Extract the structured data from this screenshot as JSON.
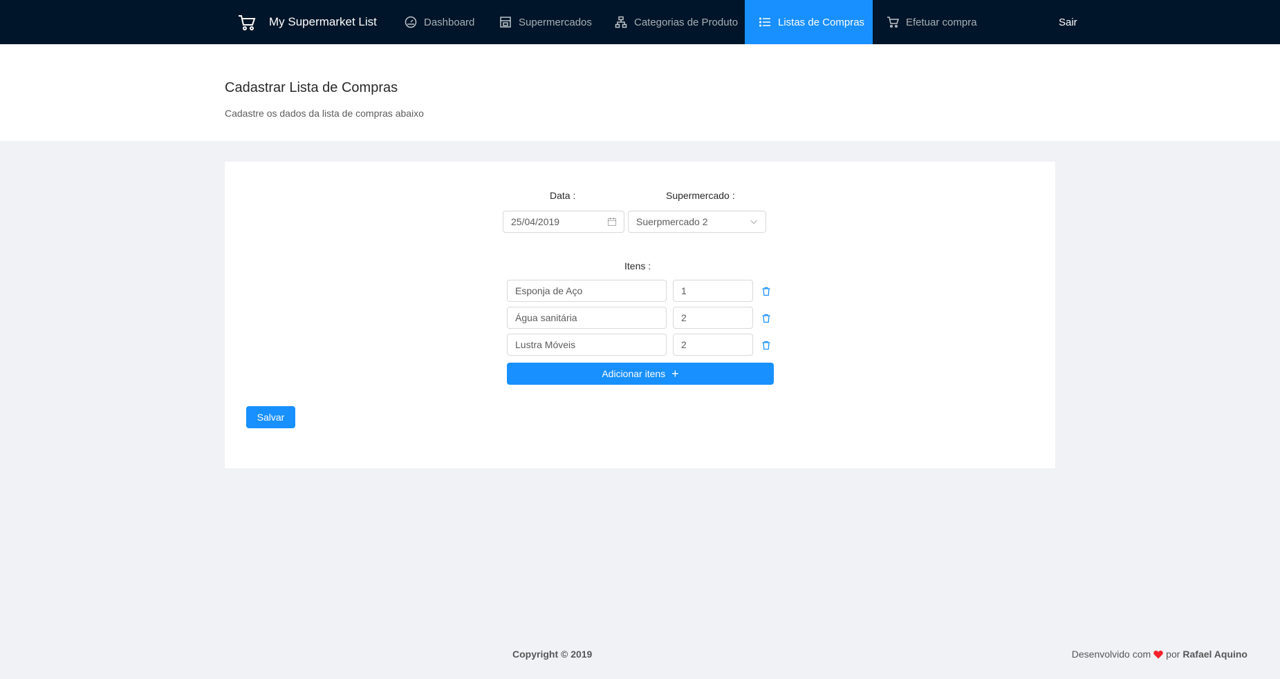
{
  "app": {
    "title": "My Supermarket List"
  },
  "nav": {
    "items": [
      {
        "label": "Dashboard",
        "icon": "dashboard-icon"
      },
      {
        "label": "Supermercados",
        "icon": "shop-icon"
      },
      {
        "label": "Categorias de Produto",
        "icon": "cluster-icon"
      },
      {
        "label": "Listas de Compras",
        "icon": "list-icon",
        "active": true
      },
      {
        "label": "Efetuar compra",
        "icon": "cart-icon"
      }
    ],
    "logout": "Sair"
  },
  "page": {
    "title": "Cadastrar Lista de Compras",
    "subtitle": "Cadastre os dados da lista de compras abaixo"
  },
  "form": {
    "date_label": "Data",
    "date_value": "25/04/2019",
    "supermarket_label": "Supermercado",
    "supermarket_value": "Suerpmercado 2",
    "items_label": "Itens",
    "items": [
      {
        "name": "Esponja de Aço",
        "quantity": "1"
      },
      {
        "name": "Água sanitária",
        "quantity": "2"
      },
      {
        "name": "Lustra Móveis",
        "quantity": "2"
      }
    ],
    "add_items_label": "Adicionar itens",
    "save_label": "Salvar"
  },
  "footer": {
    "copyright": "Copyright © 2019",
    "credit_prefix": "Desenvolvido com",
    "credit_mid": "por",
    "credit_author": "Rafael Aquino"
  },
  "colors": {
    "header_bg": "#001529",
    "accent": "#1890ff",
    "heart": "#f5222d"
  }
}
